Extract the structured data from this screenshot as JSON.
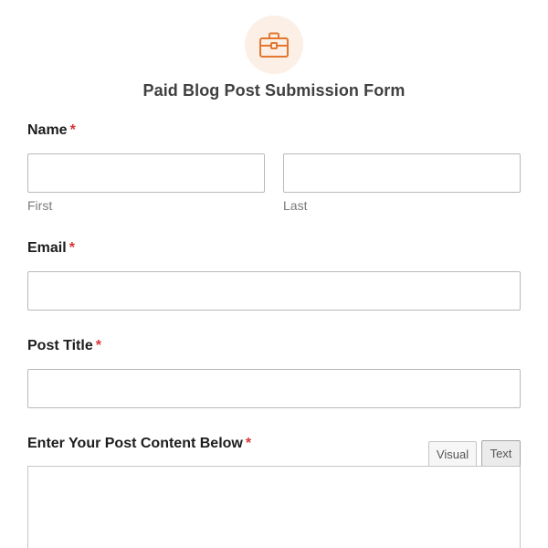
{
  "form": {
    "title": "Paid Blog Post Submission Form",
    "icon": "briefcase-icon",
    "accent_color": "#e27730",
    "icon_bg_color": "#fcefe6",
    "required_color": "#d63638"
  },
  "fields": {
    "name": {
      "label": "Name",
      "required_mark": "*",
      "first": {
        "sublabel": "First",
        "value": "",
        "placeholder": ""
      },
      "last": {
        "sublabel": "Last",
        "value": "",
        "placeholder": ""
      }
    },
    "email": {
      "label": "Email",
      "required_mark": "*",
      "value": "",
      "placeholder": ""
    },
    "post_title": {
      "label": "Post Title",
      "required_mark": "*",
      "value": "",
      "placeholder": ""
    },
    "post_content": {
      "label": "Enter Your Post Content Below",
      "required_mark": "*",
      "value": "",
      "tabs": {
        "visual": "Visual",
        "text": "Text"
      }
    }
  }
}
